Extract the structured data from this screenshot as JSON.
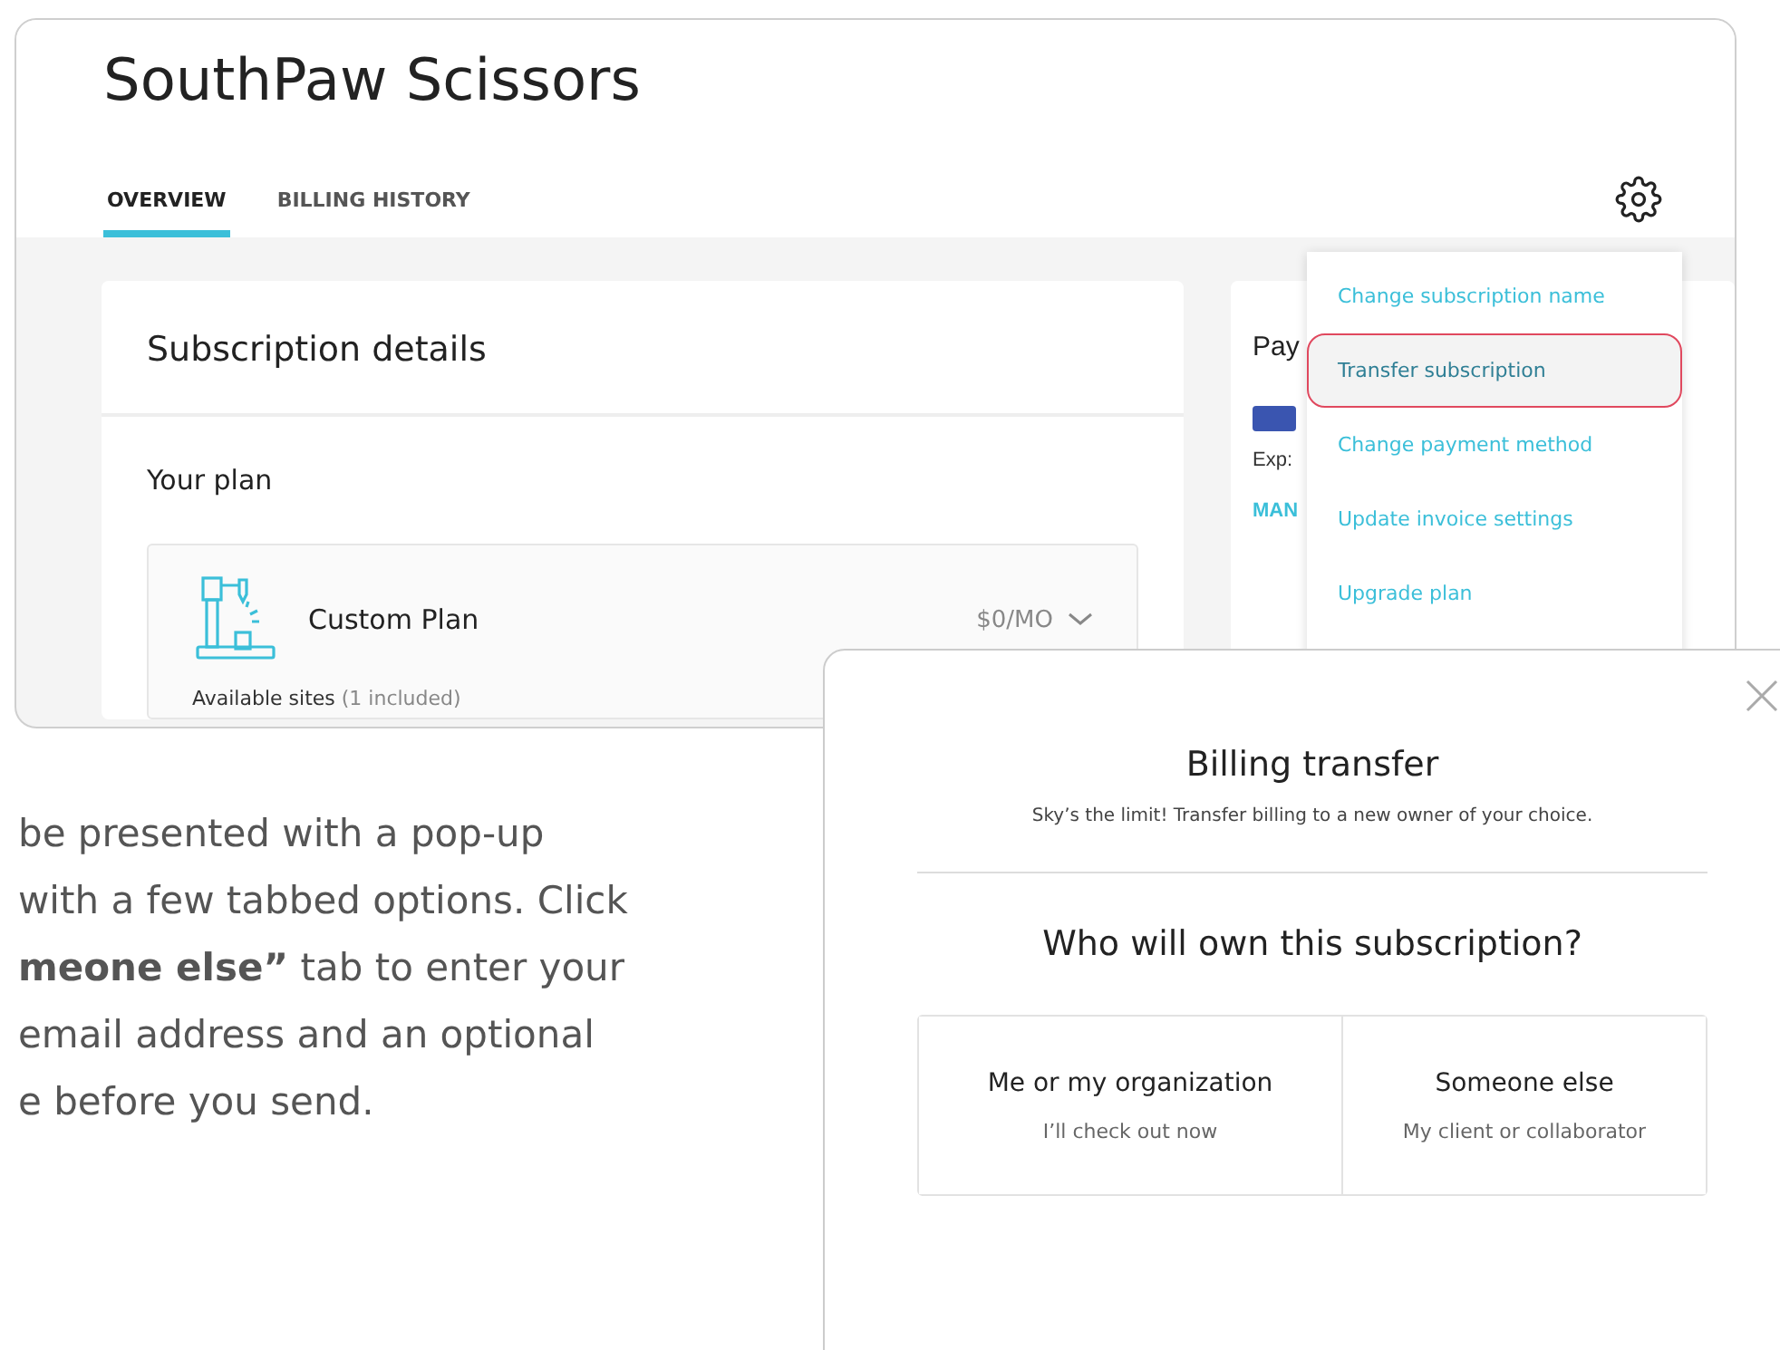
{
  "app": {
    "title": "SouthPaw Scissors",
    "tabs": [
      {
        "label": "OVERVIEW",
        "selected": true
      },
      {
        "label": "BILLING HISTORY",
        "selected": false
      }
    ],
    "subscription": {
      "heading": "Subscription details",
      "section": "Your plan",
      "plan_name": "Custom Plan",
      "price": "$0/MO",
      "sites_label": "Available sites",
      "sites_note": "(1 included)"
    },
    "payment": {
      "heading": "Pay",
      "expiry": "Exp:",
      "link": "MAN"
    },
    "menu": [
      {
        "label": "Change subscription name",
        "selected": false
      },
      {
        "label": "Transfer subscription",
        "selected": true
      },
      {
        "label": "Change payment method",
        "selected": false
      },
      {
        "label": "Update invoice settings",
        "selected": false
      },
      {
        "label": "Upgrade plan",
        "selected": false
      }
    ]
  },
  "instructions": {
    "lines": [
      "be presented with a pop-up",
      "with a few tabbed options. Click",
      "**meone else”** tab to enter your",
      "email address and an optional",
      "e before you send."
    ]
  },
  "dialog": {
    "title": "Billing transfer",
    "subtitle": "Sky’s the limit! Transfer billing to a new owner of your choice.",
    "question": "Who will own this subscription?",
    "options": [
      {
        "title": "Me or my organization",
        "note": "I’ll check out now"
      },
      {
        "title": "Someone else",
        "note": "My client or collaborator"
      }
    ]
  }
}
